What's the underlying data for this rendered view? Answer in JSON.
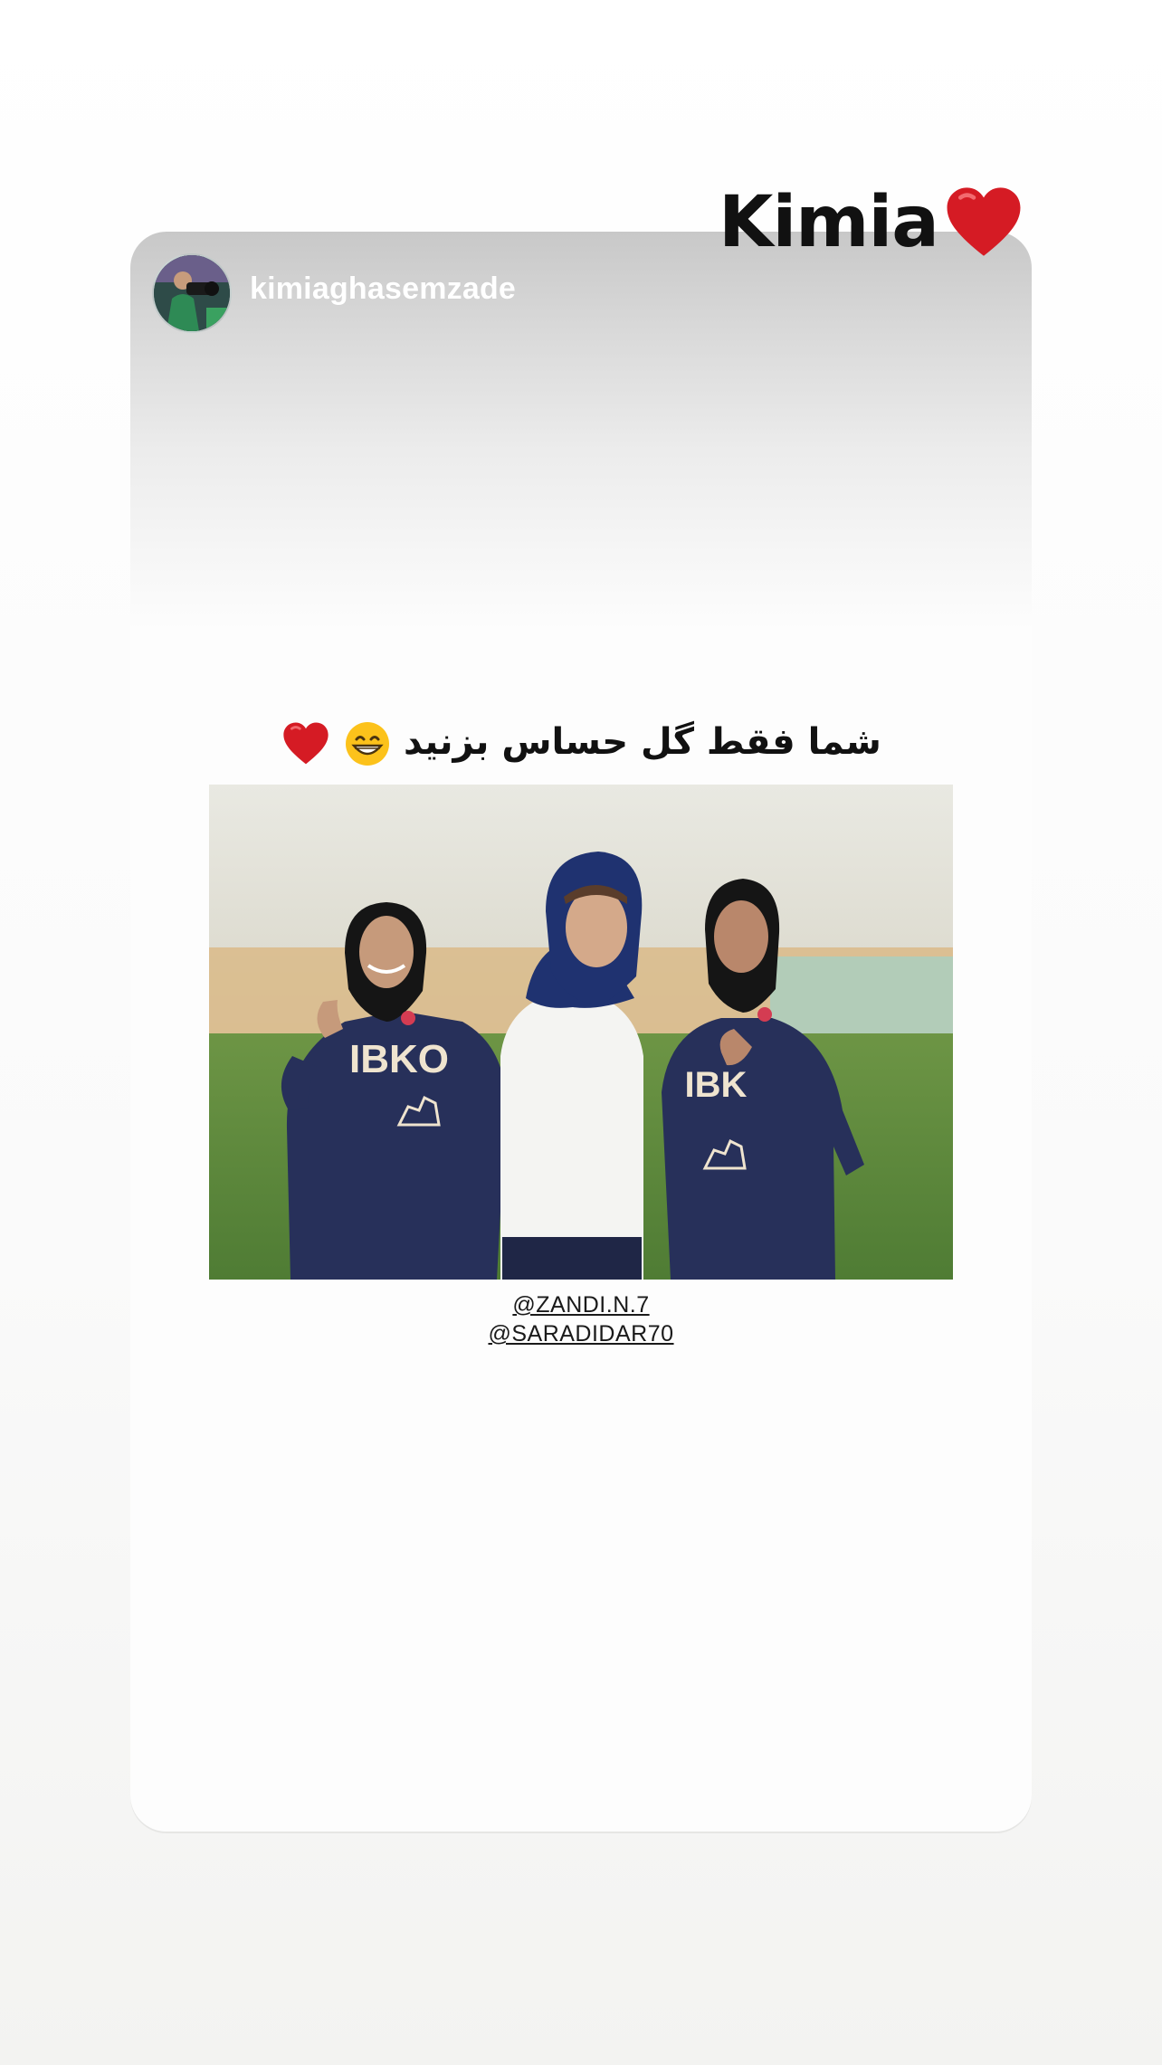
{
  "story": {
    "sticker_text": "Kimia",
    "sticker_emoji": "red-heart",
    "shared_post": {
      "username": "kimiaghasemzade",
      "caption": "شما فقط گل حساس بزنید",
      "caption_emojis": [
        "grinning-face",
        "red-heart"
      ],
      "mentions": [
        "@ZANDI.N.7",
        "@SARADIDAR70"
      ]
    }
  },
  "colors": {
    "heart": "#d51b24",
    "jersey": "#27305a",
    "pitch": "#5e8a3e"
  }
}
